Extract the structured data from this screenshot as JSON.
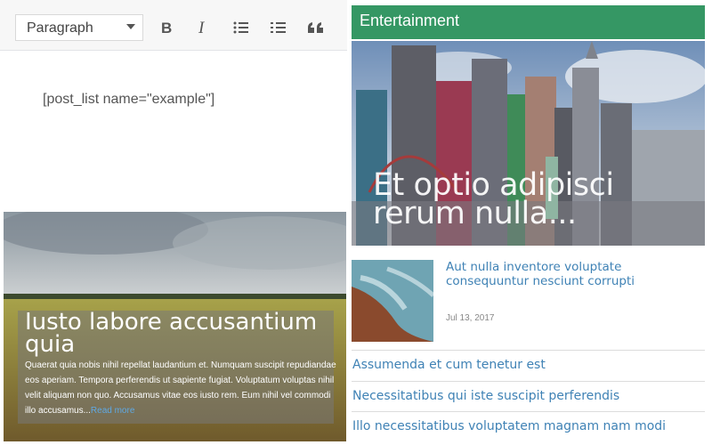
{
  "editor": {
    "format_value": "Paragraph",
    "toolbar_buttons": [
      "bold-icon",
      "italic-icon",
      "bullet-list-icon",
      "numbered-list-icon",
      "blockquote-icon"
    ],
    "shortcode": "[post_list name=\"example\"]"
  },
  "widget": {
    "title": "Entertainment",
    "title_color": "#359764",
    "featured": {
      "title": "Et optio adipisci rerum nulla..."
    },
    "small_post": {
      "title": "Aut nulla inventore voluptate consequuntur nesciunt corrupti",
      "date": "Jul 13, 2017"
    },
    "links": [
      "Assumenda et cum tenetur est",
      "Necessitatibus qui iste suscipit perferendis",
      "Illo necessitatibus voluptatem magnam nam modi"
    ],
    "link_color": "#3f82b5"
  },
  "card": {
    "title": "Iusto labore accusantium quia",
    "excerpt": "Quaerat quia nobis nihil repellat laudantium et. Numquam suscipit repudiandae eos aperiam. Tempora perferendis ut sapiente fugiat. Voluptatum voluptas nihil velit aliquam non quo. Accusamus vitae eos iusto rem. Eum nihil vel commodi illo accusamus...",
    "read_more": "Read more"
  }
}
